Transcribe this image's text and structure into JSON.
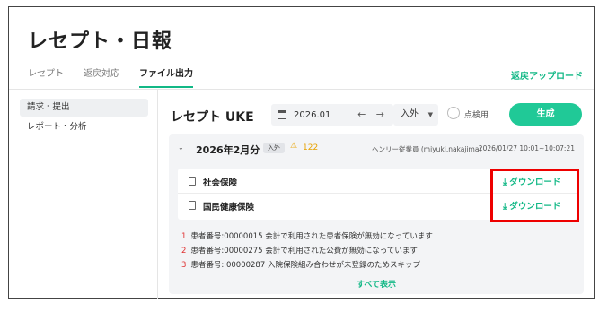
{
  "page": {
    "title": "レセプト・日報"
  },
  "tabs": [
    {
      "label": "レセプト"
    },
    {
      "label": "返戻対応"
    },
    {
      "label": "ファイル出力"
    }
  ],
  "header": {
    "return_upload": "返戻アップロード"
  },
  "sidebar": {
    "items": [
      {
        "label": "請求・提出"
      },
      {
        "label": "レポート・分析"
      }
    ]
  },
  "main": {
    "title": "レセプト UKE",
    "date": {
      "value": "2026.01",
      "arrows": "← →"
    },
    "type_select": {
      "value": "入外",
      "caret": "▼"
    },
    "radio_label": "点検用",
    "generate_button": "生成",
    "card": {
      "chevron": "⌄",
      "period": "2026年2月分",
      "badge": "入外",
      "warning_icon": "⚠",
      "warning_count": "122",
      "author": "ヘンリー従業員 (miyuki.nakajima)",
      "timestamp": "2026/01/27 10:01~10:07:21",
      "files": [
        {
          "name": "社会保険",
          "download": "ダウンロード"
        },
        {
          "name": "国民健康保険",
          "download": "ダウンロード"
        }
      ],
      "errors": [
        {
          "num": "1",
          "text": "患者番号:00000015 会計で利用された患者保険が無効になっています"
        },
        {
          "num": "2",
          "text": "患者番号:00000275 会計で利用された公費が無効になっています"
        },
        {
          "num": "3",
          "text": "患者番号: 00000287 入院保険組み合わせが未登録のためスキップ"
        }
      ],
      "show_all": "すべて表示"
    }
  },
  "colors": {
    "accent": "#12b886",
    "button": "#20c997",
    "error_number": "#e03131",
    "warning": "#e8a200",
    "highlight": "#ee0000"
  },
  "icons": [
    "calendar-icon",
    "chevron-down-icon",
    "warning-icon",
    "document-icon",
    "download-icon"
  ]
}
